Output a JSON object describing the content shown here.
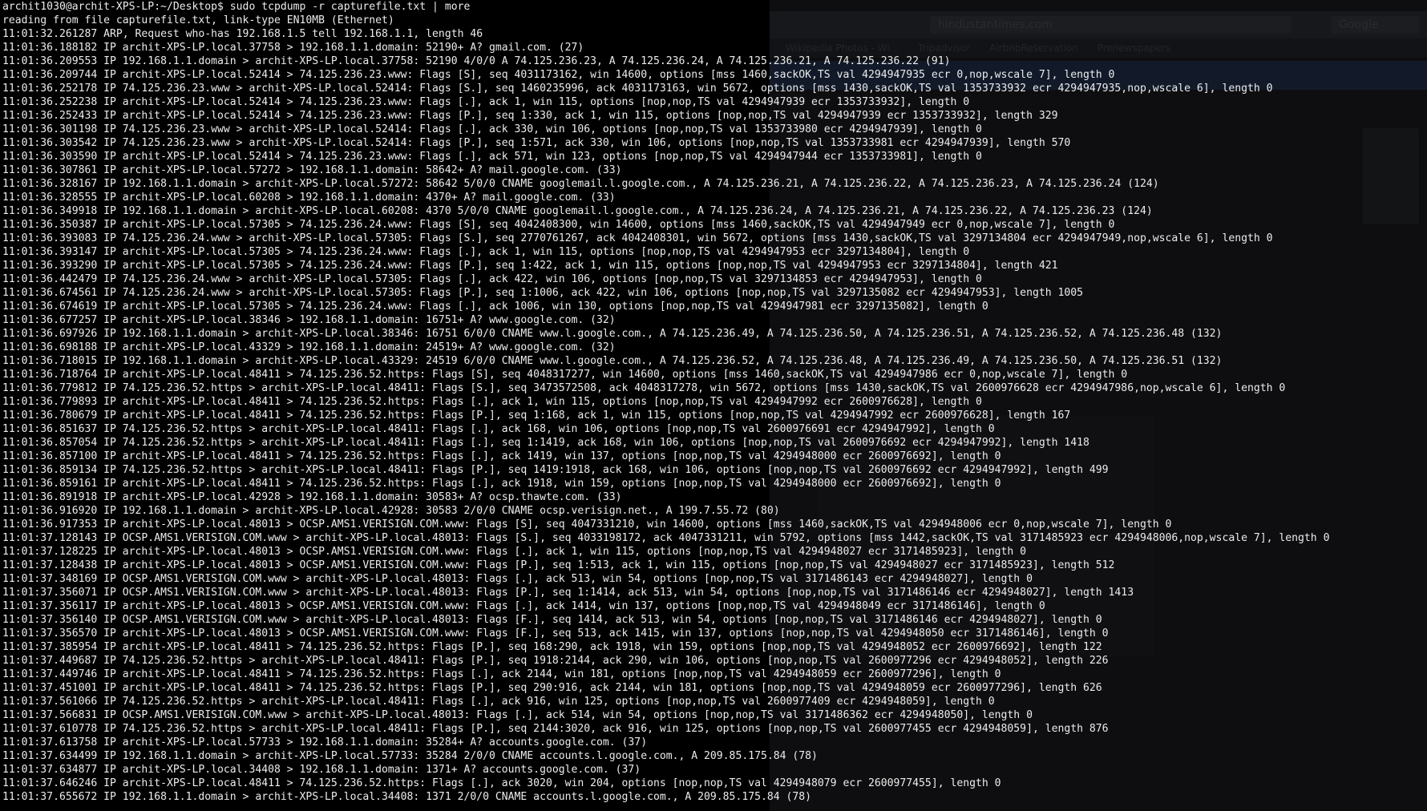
{
  "window": {
    "background_color": "#000000",
    "text_color": "#ececec"
  },
  "background_browser": {
    "url": "hindustantimes.com",
    "search_box": "Google",
    "bookmarks": [
      "Wikipedia Photos - Wi...",
      "Tripadvisor",
      "AirbnbReservation",
      "Prenewspapers"
    ]
  },
  "terminal": {
    "lines": [
      "archit1030@archit-XPS-LP:~/Desktop$ sudo tcpdump -r capturefile.txt | more",
      "reading from file capturefile.txt, link-type EN10MB (Ethernet)",
      "11:01:32.261287 ARP, Request who-has 192.168.1.5 tell 192.168.1.1, length 46",
      "11:01:36.188182 IP archit-XPS-LP.local.37758 > 192.168.1.1.domain: 52190+ A? gmail.com. (27)",
      "11:01:36.209553 IP 192.168.1.1.domain > archit-XPS-LP.local.37758: 52190 4/0/0 A 74.125.236.23, A 74.125.236.24, A 74.125.236.21, A 74.125.236.22 (91)",
      "11:01:36.209744 IP archit-XPS-LP.local.52414 > 74.125.236.23.www: Flags [S], seq 4031173162, win 14600, options [mss 1460,sackOK,TS val 4294947935 ecr 0,nop,wscale 7], length 0",
      "11:01:36.252178 IP 74.125.236.23.www > archit-XPS-LP.local.52414: Flags [S.], seq 1460235996, ack 4031173163, win 5672, options [mss 1430,sackOK,TS val 1353733932 ecr 4294947935,nop,wscale 6], length 0",
      "11:01:36.252238 IP archit-XPS-LP.local.52414 > 74.125.236.23.www: Flags [.], ack 1, win 115, options [nop,nop,TS val 4294947939 ecr 1353733932], length 0",
      "11:01:36.252433 IP archit-XPS-LP.local.52414 > 74.125.236.23.www: Flags [P.], seq 1:330, ack 1, win 115, options [nop,nop,TS val 4294947939 ecr 1353733932], length 329",
      "11:01:36.301198 IP 74.125.236.23.www > archit-XPS-LP.local.52414: Flags [.], ack 330, win 106, options [nop,nop,TS val 1353733980 ecr 4294947939], length 0",
      "11:01:36.303542 IP 74.125.236.23.www > archit-XPS-LP.local.52414: Flags [P.], seq 1:571, ack 330, win 106, options [nop,nop,TS val 1353733981 ecr 4294947939], length 570",
      "11:01:36.303590 IP archit-XPS-LP.local.52414 > 74.125.236.23.www: Flags [.], ack 571, win 123, options [nop,nop,TS val 4294947944 ecr 1353733981], length 0",
      "11:01:36.307861 IP archit-XPS-LP.local.57272 > 192.168.1.1.domain: 58642+ A? mail.google.com. (33)",
      "11:01:36.328167 IP 192.168.1.1.domain > archit-XPS-LP.local.57272: 58642 5/0/0 CNAME googlemail.l.google.com., A 74.125.236.21, A 74.125.236.22, A 74.125.236.23, A 74.125.236.24 (124)",
      "11:01:36.328555 IP archit-XPS-LP.local.60208 > 192.168.1.1.domain: 4370+ A? mail.google.com. (33)",
      "11:01:36.349918 IP 192.168.1.1.domain > archit-XPS-LP.local.60208: 4370 5/0/0 CNAME googlemail.l.google.com., A 74.125.236.24, A 74.125.236.21, A 74.125.236.22, A 74.125.236.23 (124)",
      "11:01:36.350387 IP archit-XPS-LP.local.57305 > 74.125.236.24.www: Flags [S], seq 4042408300, win 14600, options [mss 1460,sackOK,TS val 4294947949 ecr 0,nop,wscale 7], length 0",
      "11:01:36.393083 IP 74.125.236.24.www > archit-XPS-LP.local.57305: Flags [S.], seq 2770761267, ack 4042408301, win 5672, options [mss 1430,sackOK,TS val 3297134804 ecr 4294947949,nop,wscale 6], length 0",
      "11:01:36.393147 IP archit-XPS-LP.local.57305 > 74.125.236.24.www: Flags [.], ack 1, win 115, options [nop,nop,TS val 4294947953 ecr 3297134804], length 0",
      "11:01:36.393290 IP archit-XPS-LP.local.57305 > 74.125.236.24.www: Flags [P.], seq 1:422, ack 1, win 115, options [nop,nop,TS val 4294947953 ecr 3297134804], length 421",
      "11:01:36.442479 IP 74.125.236.24.www > archit-XPS-LP.local.57305: Flags [.], ack 422, win 106, options [nop,nop,TS val 3297134853 ecr 4294947953], length 0",
      "11:01:36.674561 IP 74.125.236.24.www > archit-XPS-LP.local.57305: Flags [P.], seq 1:1006, ack 422, win 106, options [nop,nop,TS val 3297135082 ecr 4294947953], length 1005",
      "11:01:36.674619 IP archit-XPS-LP.local.57305 > 74.125.236.24.www: Flags [.], ack 1006, win 130, options [nop,nop,TS val 4294947981 ecr 3297135082], length 0",
      "11:01:36.677257 IP archit-XPS-LP.local.38346 > 192.168.1.1.domain: 16751+ A? www.google.com. (32)",
      "11:01:36.697926 IP 192.168.1.1.domain > archit-XPS-LP.local.38346: 16751 6/0/0 CNAME www.l.google.com., A 74.125.236.49, A 74.125.236.50, A 74.125.236.51, A 74.125.236.52, A 74.125.236.48 (132)",
      "11:01:36.698188 IP archit-XPS-LP.local.43329 > 192.168.1.1.domain: 24519+ A? www.google.com. (32)",
      "11:01:36.718015 IP 192.168.1.1.domain > archit-XPS-LP.local.43329: 24519 6/0/0 CNAME www.l.google.com., A 74.125.236.52, A 74.125.236.48, A 74.125.236.49, A 74.125.236.50, A 74.125.236.51 (132)",
      "11:01:36.718764 IP archit-XPS-LP.local.48411 > 74.125.236.52.https: Flags [S], seq 4048317277, win 14600, options [mss 1460,sackOK,TS val 4294947986 ecr 0,nop,wscale 7], length 0",
      "11:01:36.779812 IP 74.125.236.52.https > archit-XPS-LP.local.48411: Flags [S.], seq 3473572508, ack 4048317278, win 5672, options [mss 1430,sackOK,TS val 2600976628 ecr 4294947986,nop,wscale 6], length 0",
      "11:01:36.779893 IP archit-XPS-LP.local.48411 > 74.125.236.52.https: Flags [.], ack 1, win 115, options [nop,nop,TS val 4294947992 ecr 2600976628], length 0",
      "11:01:36.780679 IP archit-XPS-LP.local.48411 > 74.125.236.52.https: Flags [P.], seq 1:168, ack 1, win 115, options [nop,nop,TS val 4294947992 ecr 2600976628], length 167",
      "11:01:36.851637 IP 74.125.236.52.https > archit-XPS-LP.local.48411: Flags [.], ack 168, win 106, options [nop,nop,TS val 2600976691 ecr 4294947992], length 0",
      "11:01:36.857054 IP 74.125.236.52.https > archit-XPS-LP.local.48411: Flags [.], seq 1:1419, ack 168, win 106, options [nop,nop,TS val 2600976692 ecr 4294947992], length 1418",
      "11:01:36.857100 IP archit-XPS-LP.local.48411 > 74.125.236.52.https: Flags [.], ack 1419, win 137, options [nop,nop,TS val 4294948000 ecr 2600976692], length 0",
      "11:01:36.859134 IP 74.125.236.52.https > archit-XPS-LP.local.48411: Flags [P.], seq 1419:1918, ack 168, win 106, options [nop,nop,TS val 2600976692 ecr 4294947992], length 499",
      "11:01:36.859161 IP archit-XPS-LP.local.48411 > 74.125.236.52.https: Flags [.], ack 1918, win 159, options [nop,nop,TS val 4294948000 ecr 2600976692], length 0",
      "11:01:36.891918 IP archit-XPS-LP.local.42928 > 192.168.1.1.domain: 30583+ A? ocsp.thawte.com. (33)",
      "11:01:36.916920 IP 192.168.1.1.domain > archit-XPS-LP.local.42928: 30583 2/0/0 CNAME ocsp.verisign.net., A 199.7.55.72 (80)",
      "11:01:36.917353 IP archit-XPS-LP.local.48013 > OCSP.AMS1.VERISIGN.COM.www: Flags [S], seq 4047331210, win 14600, options [mss 1460,sackOK,TS val 4294948006 ecr 0,nop,wscale 7], length 0",
      "11:01:37.128143 IP OCSP.AMS1.VERISIGN.COM.www > archit-XPS-LP.local.48013: Flags [S.], seq 4033198172, ack 4047331211, win 5792, options [mss 1442,sackOK,TS val 3171485923 ecr 4294948006,nop,wscale 7], length 0",
      "11:01:37.128225 IP archit-XPS-LP.local.48013 > OCSP.AMS1.VERISIGN.COM.www: Flags [.], ack 1, win 115, options [nop,nop,TS val 4294948027 ecr 3171485923], length 0",
      "11:01:37.128438 IP archit-XPS-LP.local.48013 > OCSP.AMS1.VERISIGN.COM.www: Flags [P.], seq 1:513, ack 1, win 115, options [nop,nop,TS val 4294948027 ecr 3171485923], length 512",
      "11:01:37.348169 IP OCSP.AMS1.VERISIGN.COM.www > archit-XPS-LP.local.48013: Flags [.], ack 513, win 54, options [nop,nop,TS val 3171486143 ecr 4294948027], length 0",
      "11:01:37.356071 IP OCSP.AMS1.VERISIGN.COM.www > archit-XPS-LP.local.48013: Flags [P.], seq 1:1414, ack 513, win 54, options [nop,nop,TS val 3171486146 ecr 4294948027], length 1413",
      "11:01:37.356117 IP archit-XPS-LP.local.48013 > OCSP.AMS1.VERISIGN.COM.www: Flags [.], ack 1414, win 137, options [nop,nop,TS val 4294948049 ecr 3171486146], length 0",
      "11:01:37.356140 IP OCSP.AMS1.VERISIGN.COM.www > archit-XPS-LP.local.48013: Flags [F.], seq 1414, ack 513, win 54, options [nop,nop,TS val 3171486146 ecr 4294948027], length 0",
      "11:01:37.356570 IP archit-XPS-LP.local.48013 > OCSP.AMS1.VERISIGN.COM.www: Flags [F.], seq 513, ack 1415, win 137, options [nop,nop,TS val 4294948050 ecr 3171486146], length 0",
      "11:01:37.385954 IP archit-XPS-LP.local.48411 > 74.125.236.52.https: Flags [P.], seq 168:290, ack 1918, win 159, options [nop,nop,TS val 4294948052 ecr 2600976692], length 122",
      "11:01:37.449687 IP 74.125.236.52.https > archit-XPS-LP.local.48411: Flags [P.], seq 1918:2144, ack 290, win 106, options [nop,nop,TS val 2600977296 ecr 4294948052], length 226",
      "11:01:37.449746 IP archit-XPS-LP.local.48411 > 74.125.236.52.https: Flags [.], ack 2144, win 181, options [nop,nop,TS val 4294948059 ecr 2600977296], length 0",
      "11:01:37.451001 IP archit-XPS-LP.local.48411 > 74.125.236.52.https: Flags [P.], seq 290:916, ack 2144, win 181, options [nop,nop,TS val 4294948059 ecr 2600977296], length 626",
      "11:01:37.561066 IP 74.125.236.52.https > archit-XPS-LP.local.48411: Flags [.], ack 916, win 125, options [nop,nop,TS val 2600977409 ecr 4294948059], length 0",
      "11:01:37.566831 IP OCSP.AMS1.VERISIGN.COM.www > archit-XPS-LP.local.48013: Flags [.], ack 514, win 54, options [nop,nop,TS val 3171486362 ecr 4294948050], length 0",
      "11:01:37.610778 IP 74.125.236.52.https > archit-XPS-LP.local.48411: Flags [P.], seq 2144:3020, ack 916, win 125, options [nop,nop,TS val 2600977455 ecr 4294948059], length 876",
      "11:01:37.613758 IP archit-XPS-LP.local.57733 > 192.168.1.1.domain: 35284+ A? accounts.google.com. (37)",
      "11:01:37.634499 IP 192.168.1.1.domain > archit-XPS-LP.local.57733: 35284 2/0/0 CNAME accounts.l.google.com., A 209.85.175.84 (78)",
      "11:01:37.634877 IP archit-XPS-LP.local.34408 > 192.168.1.1.domain: 1371+ A? accounts.google.com. (37)",
      "11:01:37.646246 IP archit-XPS-LP.local.48411 > 74.125.236.52.https: Flags [.], ack 3020, win 204, options [nop,nop,TS val 4294948079 ecr 2600977455], length 0",
      "11:01:37.655672 IP 192.168.1.1.domain > archit-XPS-LP.local.34408: 1371 2/0/0 CNAME accounts.l.google.com., A 209.85.175.84 (78)"
    ]
  }
}
